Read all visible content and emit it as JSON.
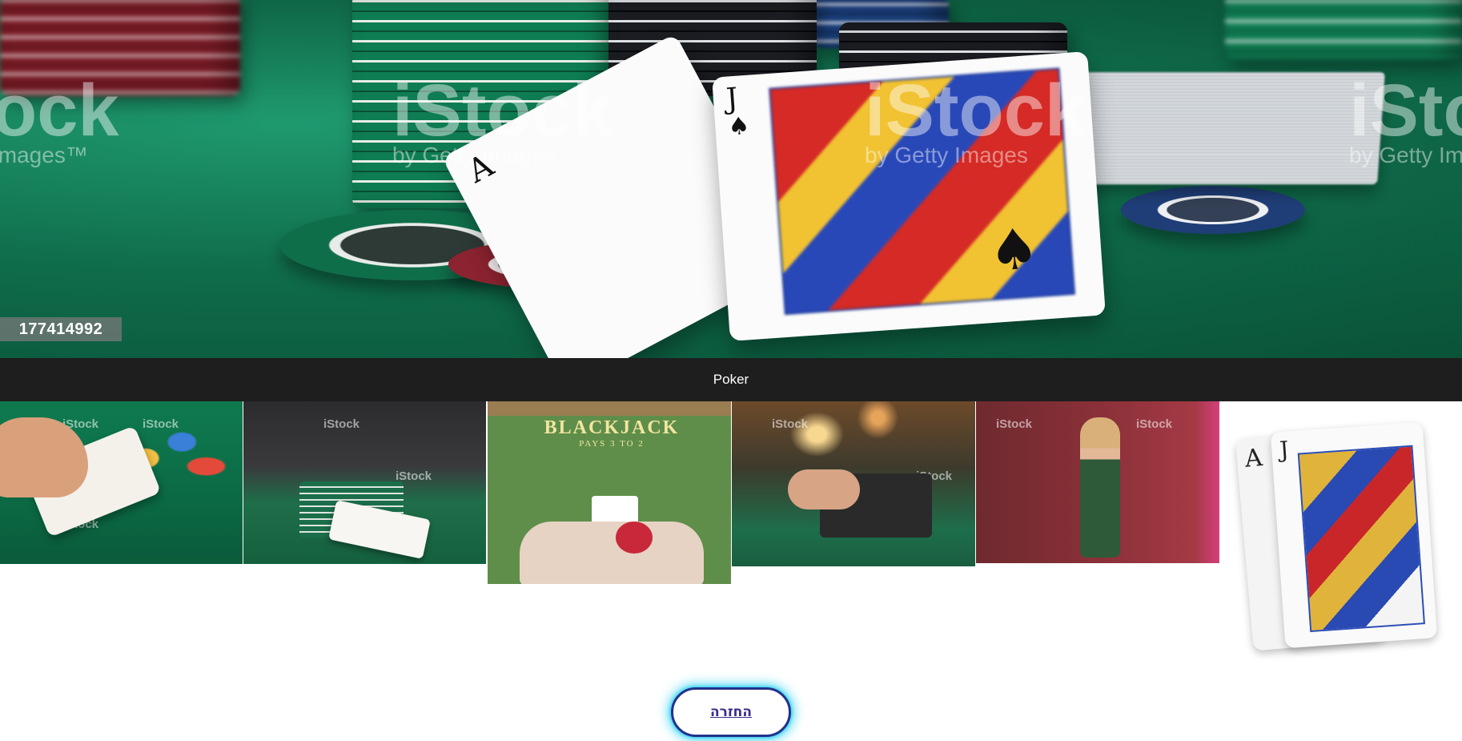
{
  "hero": {
    "image_id": "177414992",
    "watermark_brand": "iStock",
    "watermark_sub": "by Getty Images"
  },
  "gallery": {
    "title": "Poker",
    "thumbnails": [
      {
        "name": "hand-with-cards-and-chips"
      },
      {
        "name": "dealer-with-chips-and-cards"
      },
      {
        "name": "blackjack-table-top-view",
        "table_text": "BLACKJACK",
        "table_sub": "PAYS 3 TO 2"
      },
      {
        "name": "online-poker-laptop"
      },
      {
        "name": "woman-in-green-dress-with-cards"
      },
      {
        "name": "ace-and-jack-of-spades"
      }
    ]
  },
  "navigation": {
    "back_label": "החזרה"
  },
  "colors": {
    "title_bar_bg": "#1e1e1e",
    "button_border": "#23318a",
    "button_glow": "#24d0f0",
    "felt_green": "#10724f"
  }
}
